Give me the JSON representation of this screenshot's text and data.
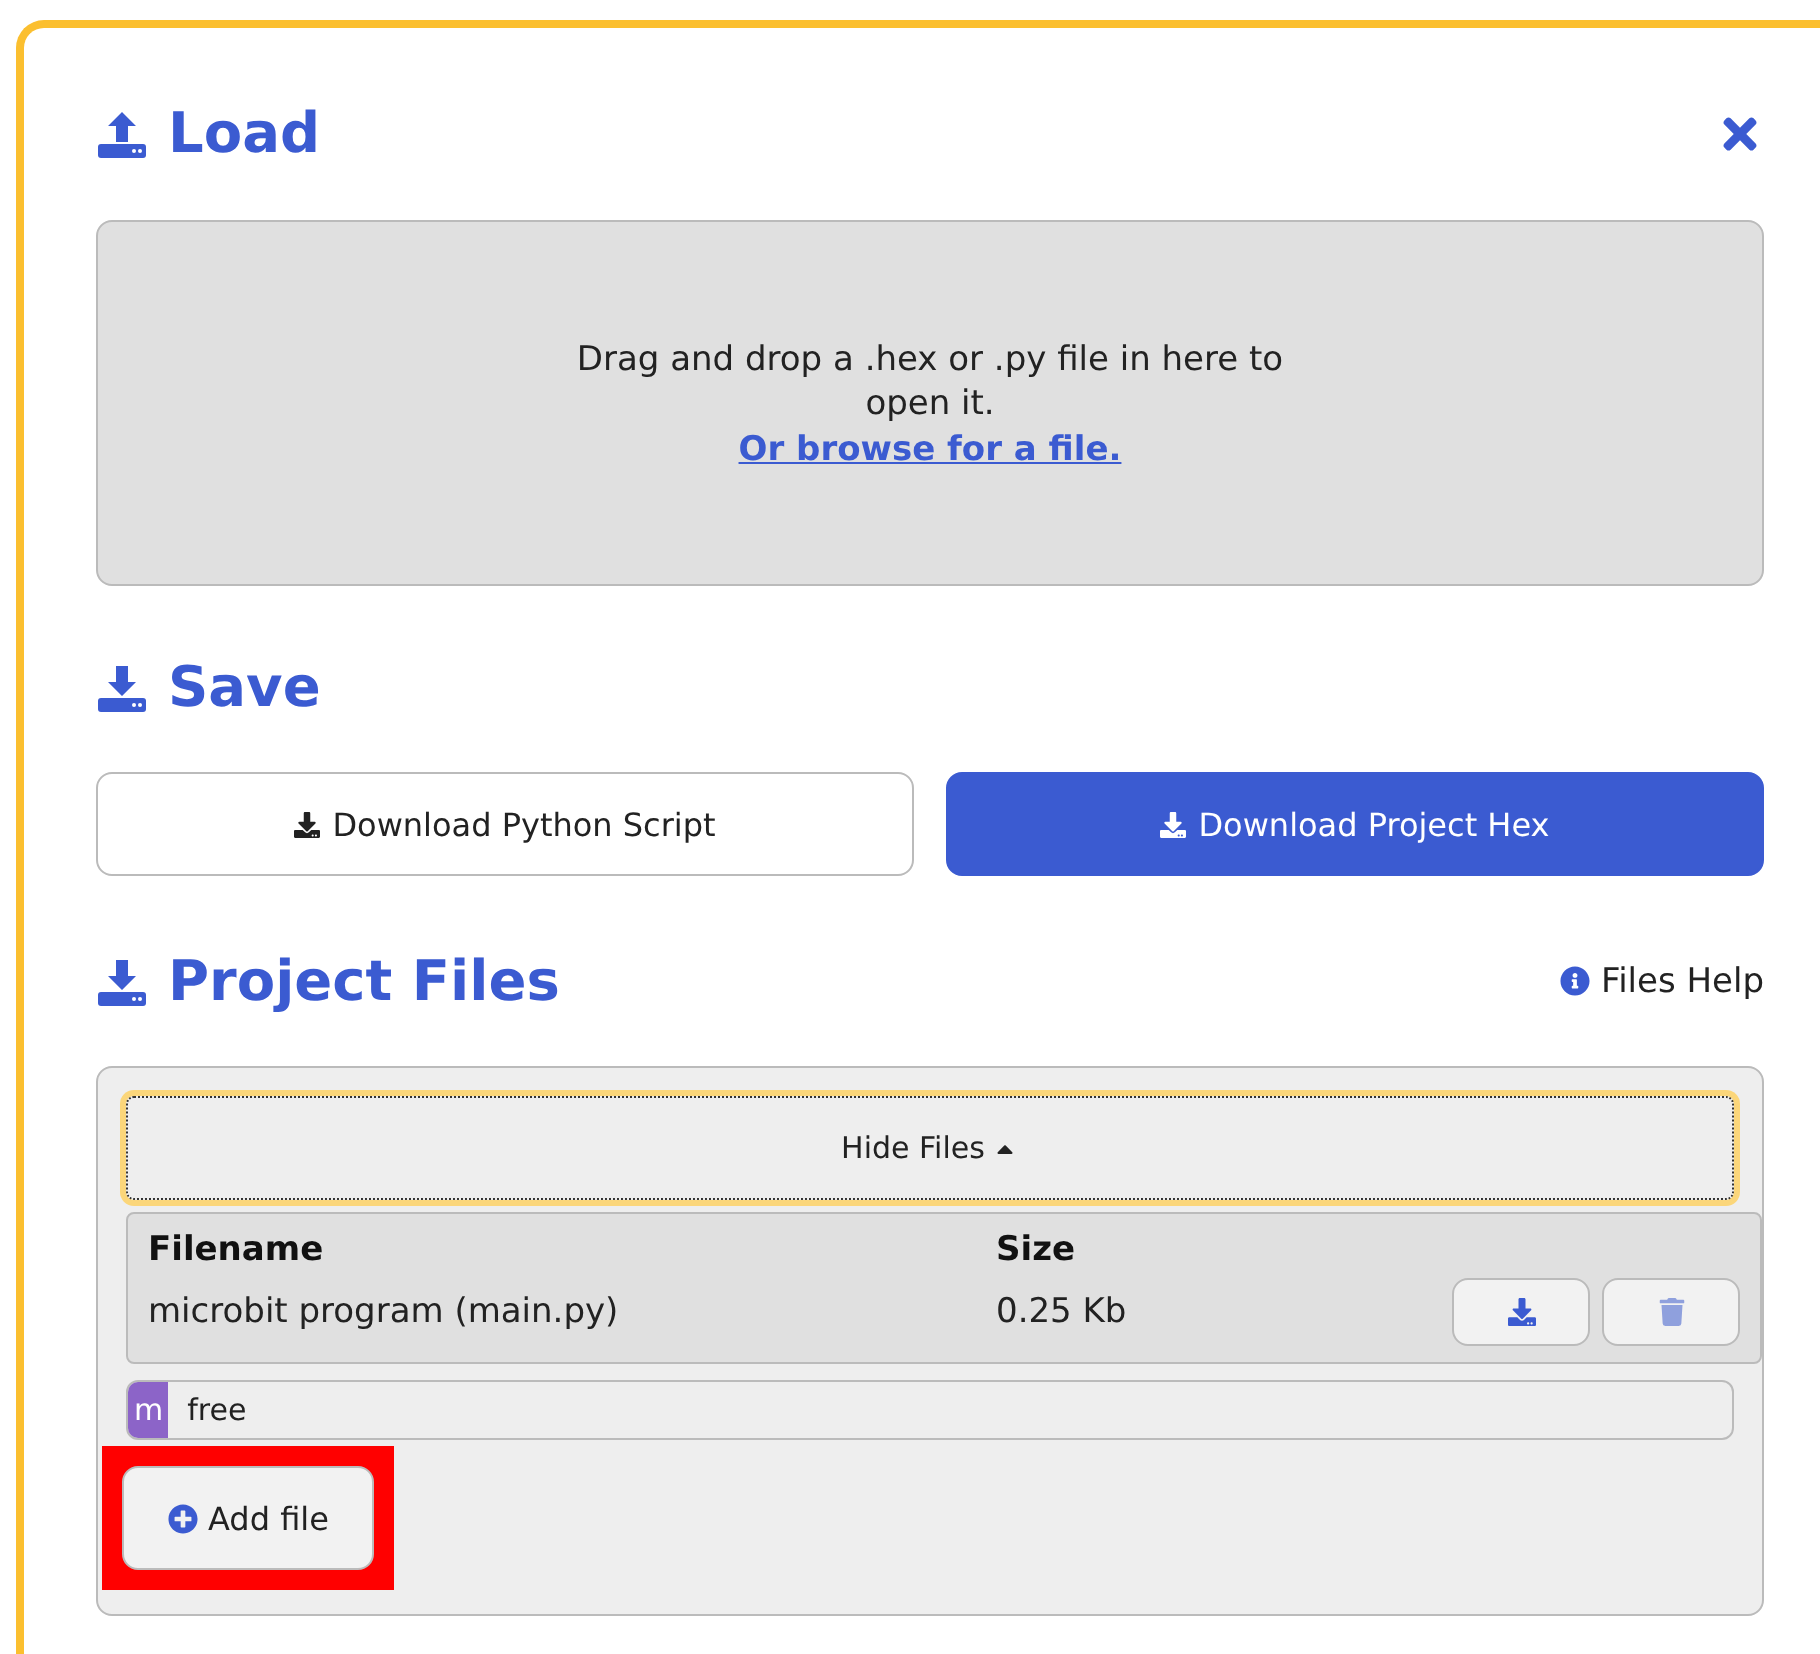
{
  "load": {
    "title": "Load",
    "dropzone_text": "Drag and drop a .hex or .py file in here to open it.",
    "browse_link": "Or browse for a file."
  },
  "save": {
    "title": "Save",
    "buttons": [
      {
        "label": "Download Python Script",
        "primary": false
      },
      {
        "label": "Download Project Hex",
        "primary": true
      }
    ]
  },
  "project_files": {
    "title": "Project Files",
    "help_link": "Files Help",
    "toggle": {
      "label": "Hide Files",
      "expanded": true,
      "focused": true
    },
    "columns": [
      "Filename",
      "Size"
    ],
    "rows": [
      {
        "filename": "microbit program (main.py)",
        "size": "0.25 Kb",
        "delete_disabled": true
      }
    ],
    "storage": {
      "used_label": "m",
      "level": 0.018,
      "free_label": "free"
    },
    "add_button": {
      "label": "Add file",
      "highlighted": true
    }
  }
}
